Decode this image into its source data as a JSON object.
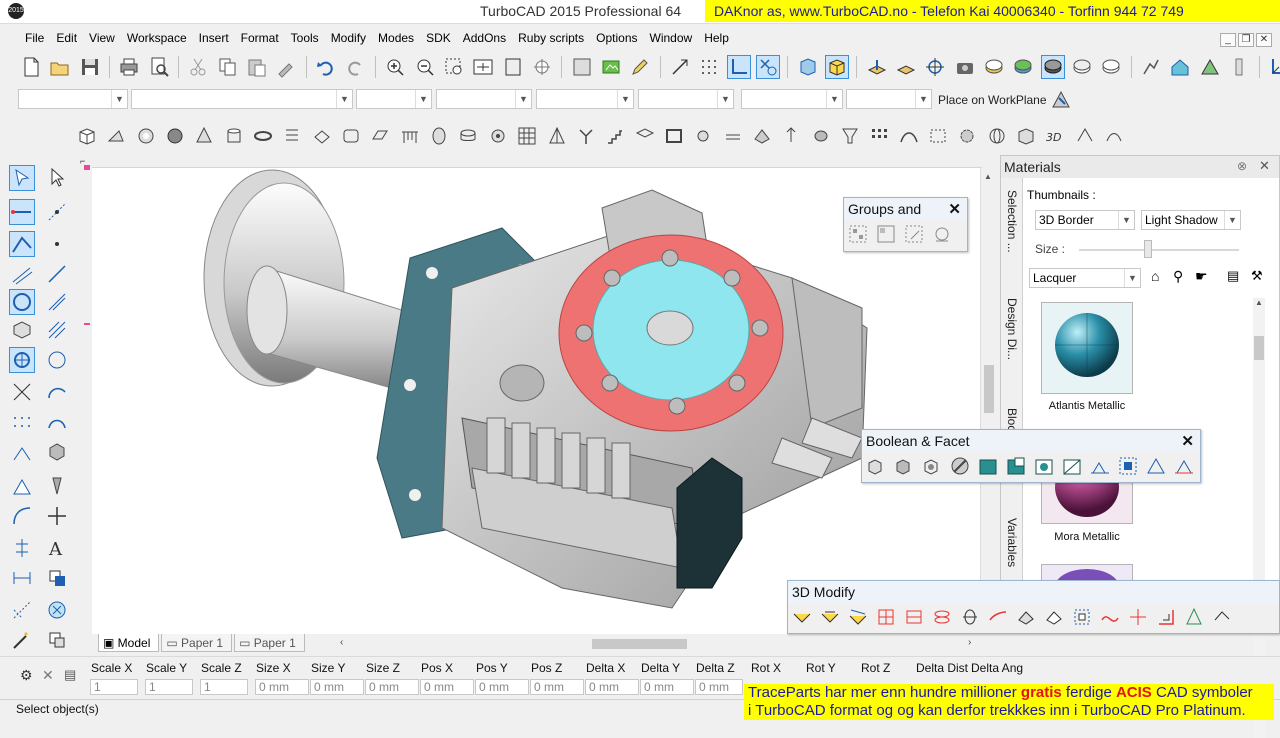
{
  "titlebar": {
    "app_icon_text": "2015",
    "title": "TurboCAD 2015 Professional 64",
    "banner": "DAKnor as, www.TurboCAD.no - Telefon Kai 40006340 - Torfinn 944 72 749"
  },
  "menu": [
    "File",
    "Edit",
    "View",
    "Workspace",
    "Insert",
    "Format",
    "Tools",
    "Modify",
    "Modes",
    "SDK",
    "AddOns",
    "Ruby scripts",
    "Options",
    "Window",
    "Help"
  ],
  "mdi": {
    "minimize": "_",
    "restore": "❐",
    "close": "✕"
  },
  "property_row": {
    "workplane_label": "Place on WorkPlane"
  },
  "tabs": [
    {
      "label": "Model",
      "active": true
    },
    {
      "label": "Paper 1",
      "active": false
    },
    {
      "label": "Paper 1",
      "active": false
    }
  ],
  "materials": {
    "title": "Materials",
    "thumbnails_label": "Thumbnails :",
    "thumb_style": "3D Border",
    "shadow_style": "Light Shadow",
    "size_label": "Size :",
    "library": "Lacquer",
    "side_tabs": [
      "Selection ...",
      "Design Di...",
      "Blocks",
      "Variables"
    ],
    "items": [
      {
        "name": "Atlantis Metallic",
        "color": "#2a8fa8"
      },
      {
        "name": "Mora Metallic",
        "color": "#b04a8c"
      },
      {
        "name": "",
        "color": "#7a4fb8"
      }
    ]
  },
  "palettes": {
    "groups": {
      "title": "Groups and",
      "close": "✕"
    },
    "boolean": {
      "title": "Boolean & Facet",
      "close": "✕"
    },
    "modify3d": {
      "title": "3D Modify"
    }
  },
  "propbar": {
    "fields": [
      {
        "label": "Scale X",
        "value": "1"
      },
      {
        "label": "Scale Y",
        "value": "1"
      },
      {
        "label": "Scale Z",
        "value": "1"
      },
      {
        "label": "Size X",
        "value": "0 mm"
      },
      {
        "label": "Size Y",
        "value": "0 mm"
      },
      {
        "label": "Size Z",
        "value": "0 mm"
      },
      {
        "label": "Pos X",
        "value": "0 mm"
      },
      {
        "label": "Pos Y",
        "value": "0 mm"
      },
      {
        "label": "Pos Z",
        "value": "0 mm"
      },
      {
        "label": "Delta X",
        "value": "0 mm"
      },
      {
        "label": "Delta Y",
        "value": "0 mm"
      },
      {
        "label": "Delta Z",
        "value": "0 mm"
      },
      {
        "label": "Rot X",
        "value": ""
      },
      {
        "label": "Rot Y",
        "value": ""
      },
      {
        "label": "Rot Z",
        "value": ""
      },
      {
        "label": "Delta Dist",
        "value": ""
      },
      {
        "label": "Delta Ang",
        "value": ""
      }
    ]
  },
  "status": {
    "text": "Select object(s)"
  },
  "banner_bottom": {
    "line1_a": "TraceParts har mer enn hundre millioner ",
    "line1_b": "gratis",
    "line1_c": " ferdige ",
    "line1_d": "ACIS",
    "line1_e": " CAD symboler",
    "line2": "i TurboCAD format og  og kan derfor trekkkes inn i TurboCAD Pro Platinum."
  },
  "colors": {
    "accent": "#3b8fd6",
    "banner_bg": "#ffff00",
    "banner_text": "#1a1aa0",
    "model_flange": "#4a7a86",
    "model_highlight_ring": "#ef7272",
    "model_highlight_face": "#8fe6ee"
  }
}
